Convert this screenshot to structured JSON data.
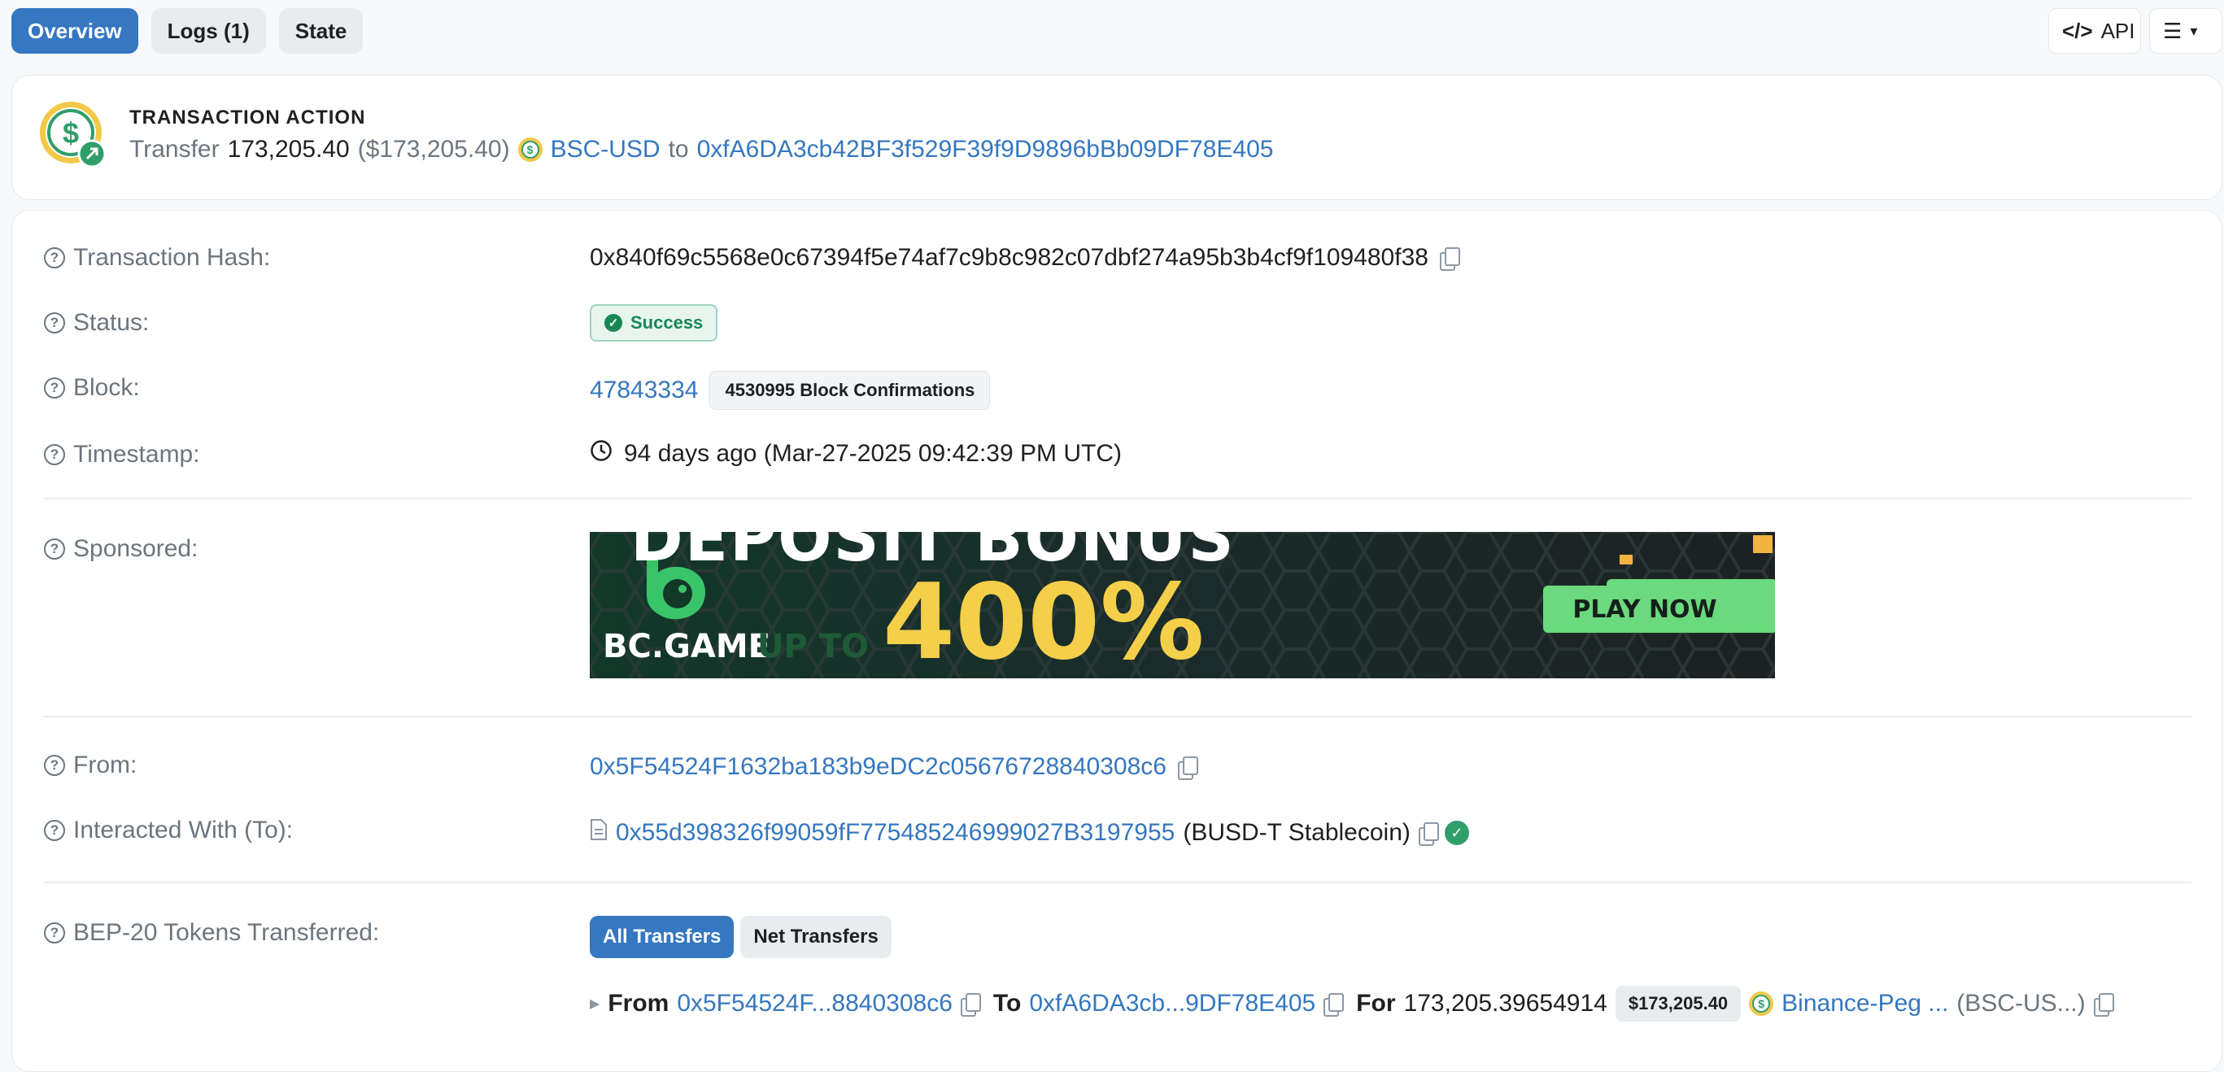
{
  "tabs": [
    {
      "label": "Overview",
      "active": true
    },
    {
      "label": "Logs (1)",
      "active": false
    },
    {
      "label": "State",
      "active": false
    }
  ],
  "toolbar": {
    "api_label": "API"
  },
  "action": {
    "title": "TRANSACTION ACTION",
    "verb": "Transfer",
    "amount": "173,205.40",
    "usd": "($173,205.40)",
    "token": "BSC-USD",
    "to_word": "to",
    "to_address": "0xfA6DA3cb42BF3f529F39f9D9896bBb09DF78E405"
  },
  "details": {
    "tx_hash_label": "Transaction Hash:",
    "tx_hash": "0x840f69c5568e0c67394f5e74af7c9b8c982c07dbf274a95b3b4cf9f109480f38",
    "status_label": "Status:",
    "status": "Success",
    "block_label": "Block:",
    "block": "47843334",
    "confirmations": "4530995 Block Confirmations",
    "timestamp_label": "Timestamp:",
    "timestamp": "94 days ago (Mar-27-2025 09:42:39 PM UTC)",
    "sponsored_label": "Sponsored:",
    "from_label": "From:",
    "from": "0x5F54524F1632ba183b9eDC2c05676728840308c6",
    "to_label": "Interacted With (To):",
    "to_contract": "0x55d398326f99059fF775485246999027B3197955",
    "to_name": "(BUSD-T Stablecoin)",
    "tokens_label": "BEP-20 Tokens Transferred:"
  },
  "ad": {
    "top_text": "DEPOSIT BONUS",
    "brand": "BC.GAME",
    "up_to": "UP TO",
    "percent": "400%",
    "cta": "PLAY NOW"
  },
  "transfers": {
    "tabs": [
      "All Transfers",
      "Net Transfers"
    ],
    "from_word": "From",
    "from": "0x5F54524F...8840308c6",
    "to_word": "To",
    "to": "0xfA6DA3cb...9DF78E405",
    "for_word": "For",
    "amount": "173,205.39654914",
    "usd": "$173,205.40",
    "token": "Binance-Peg ...",
    "token_symbol": "(BSC-US...)"
  },
  "colors": {
    "accent": "#3577c0",
    "success": "#198754"
  }
}
